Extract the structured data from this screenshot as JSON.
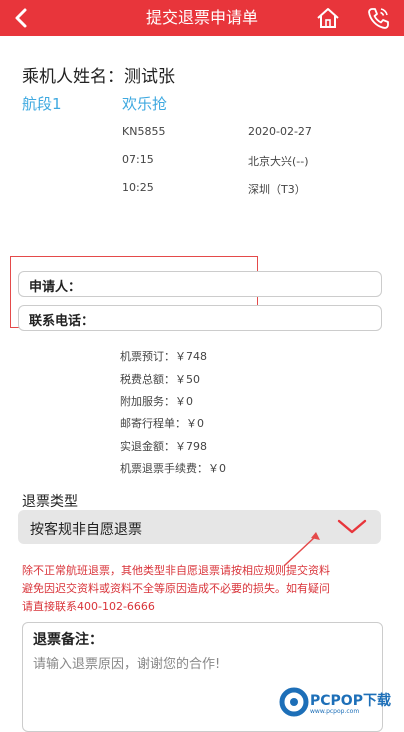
{
  "header": {
    "title": "提交退票申请单"
  },
  "passenger": {
    "label_value": "乘机人姓名：测试张"
  },
  "segment": {
    "label": "航段1",
    "fare_name": "欢乐抢",
    "flight_no": "KN5855",
    "date": "2020-02-27",
    "depart_time": "07:15",
    "depart_airport": "北京大兴(--)",
    "arrive_time": "10:25",
    "arrive_airport": "深圳（T3）"
  },
  "form": {
    "applicant_label": "申请人：",
    "applicant_value": "",
    "phone_label": "联系电话：",
    "phone_value": ""
  },
  "fees": [
    "机票预订：￥748",
    "税费总额：￥50",
    "附加服务：￥0",
    "邮寄行程单：￥0",
    "实退金额：￥798",
    "机票退票手续费：￥0"
  ],
  "refund_type": {
    "label": "退票类型",
    "selected": "按客规非自愿退票"
  },
  "warning": [
    "除不正常航班退票，其他类型非自愿退票请按相应规则提交资料",
    "避免因迟交资料或资料不全等原因造成不必要的损失。如有疑问",
    "请直接联系400-102-6666"
  ],
  "remarks": {
    "label": "退票备注：",
    "placeholder": "请输入退票原因，谢谢您的合作!"
  },
  "watermark": {
    "text": "PCPOP下载",
    "sub": "www.pcpop.com"
  },
  "colors": {
    "brand": "#e8353b",
    "accent": "#3fa9e0",
    "warning": "#d9343a"
  }
}
